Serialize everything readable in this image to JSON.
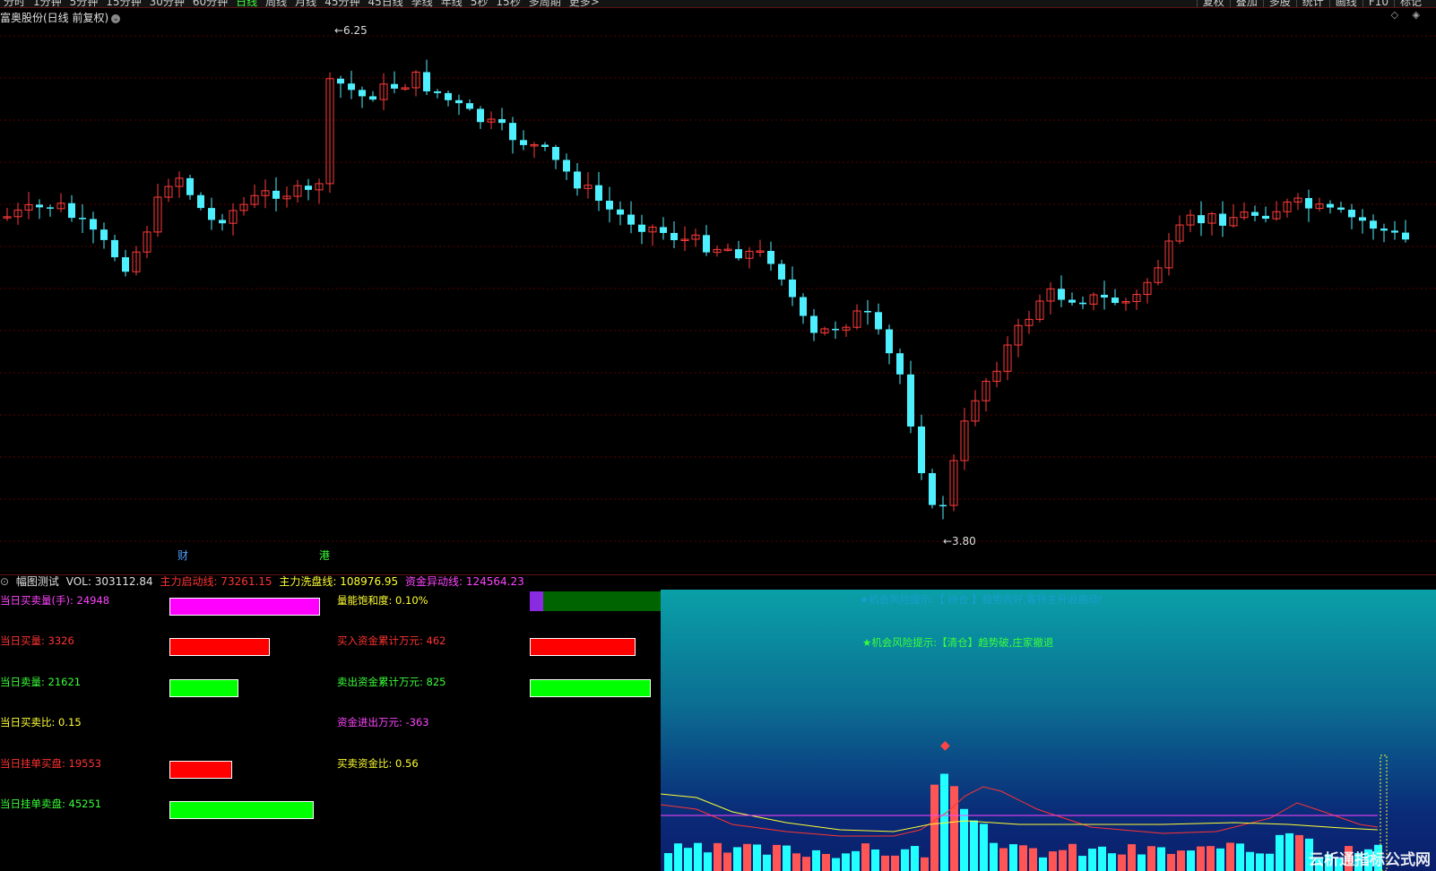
{
  "top_menu": {
    "items": [
      "分时",
      "1分钟",
      "5分钟",
      "15分钟",
      "30分钟",
      "60分钟",
      "日线",
      "周线",
      "月线",
      "45分钟",
      "45日线",
      "季线",
      "年线",
      "5秒",
      "15秒",
      "多周期",
      "更多>"
    ],
    "right_items": [
      "复权",
      "叠加",
      "多股",
      "统计",
      "画线",
      "F10",
      "标记"
    ]
  },
  "chart_title": "富奥股份(日线 前复权)",
  "title_chevron": "⌄",
  "corner_icons": "◇ ◈",
  "main_chart": {
    "high_label": "6.25",
    "low_label": "3.80",
    "markers": [
      {
        "text": "财",
        "color": "#4aa0ff"
      },
      {
        "text": "港",
        "color": "#39ff39"
      }
    ],
    "colors": {
      "up": "#ff3b3b",
      "down": "#4ef0ff",
      "grid": "#5a0000"
    }
  },
  "indicator_header": {
    "name": "幅图测试",
    "vol": "VOL: 303112.84",
    "line1": "主力启动线: 73261.15",
    "line2": "主力洗盘线: 108976.95",
    "line3": "资金异动线: 124564.23",
    "colors": {
      "name": "#e0e0e0",
      "vol": "#e0e0e0",
      "line1": "#ff3333",
      "line2": "#ffff33",
      "line3": "#ff44ff"
    }
  },
  "left_stats": [
    {
      "label": "当日买卖量(手): 24948",
      "color": "#ff44ff"
    },
    {
      "label": "当日买量: 3326",
      "color": "#ff3333"
    },
    {
      "label": "当日卖量: 21621",
      "color": "#39ff39"
    },
    {
      "label": "当日买卖比: 0.15",
      "color": "#ffff33"
    },
    {
      "label": "当日挂单买盘: 19553",
      "color": "#ff3333"
    },
    {
      "label": "当日挂单卖盘: 45251",
      "color": "#39ff39"
    }
  ],
  "mid_stats": [
    {
      "label": "量能饱和度: 0.10%",
      "color": "#ffff33"
    },
    {
      "label": "买入资金累计万元: 462",
      "color": "#ff3333"
    },
    {
      "label": "卖出资金累计万元: 825",
      "color": "#39ff39"
    },
    {
      "label": "资金进出万元: -363",
      "color": "#ff44ff"
    },
    {
      "label": "买卖资金比: 0.56",
      "color": "#ffff33"
    }
  ],
  "bars": {
    "left": [
      {
        "value": 24948,
        "color": "#ff00ff"
      },
      {
        "value": 3326,
        "color": "#ff0000"
      },
      {
        "value": 21621,
        "color": "#00ff00"
      },
      {
        "value": 19553,
        "color": "#ff0000"
      },
      {
        "value": 45251,
        "color": "#00ff00"
      }
    ],
    "saturation_pct": 0.1,
    "saturation_colors": {
      "filled": "#8a2be2",
      "rest": "#006400"
    },
    "buy_funds": 462,
    "sell_funds": 825
  },
  "right_panel": {
    "text1": "★机会风险提示:【 持仓 】趋势向好,等待主升浪启动!",
    "text2": "★机会风险提示:【清仓】趋势破,庄家撤退",
    "watermark": "云析通指标公式网"
  }
}
